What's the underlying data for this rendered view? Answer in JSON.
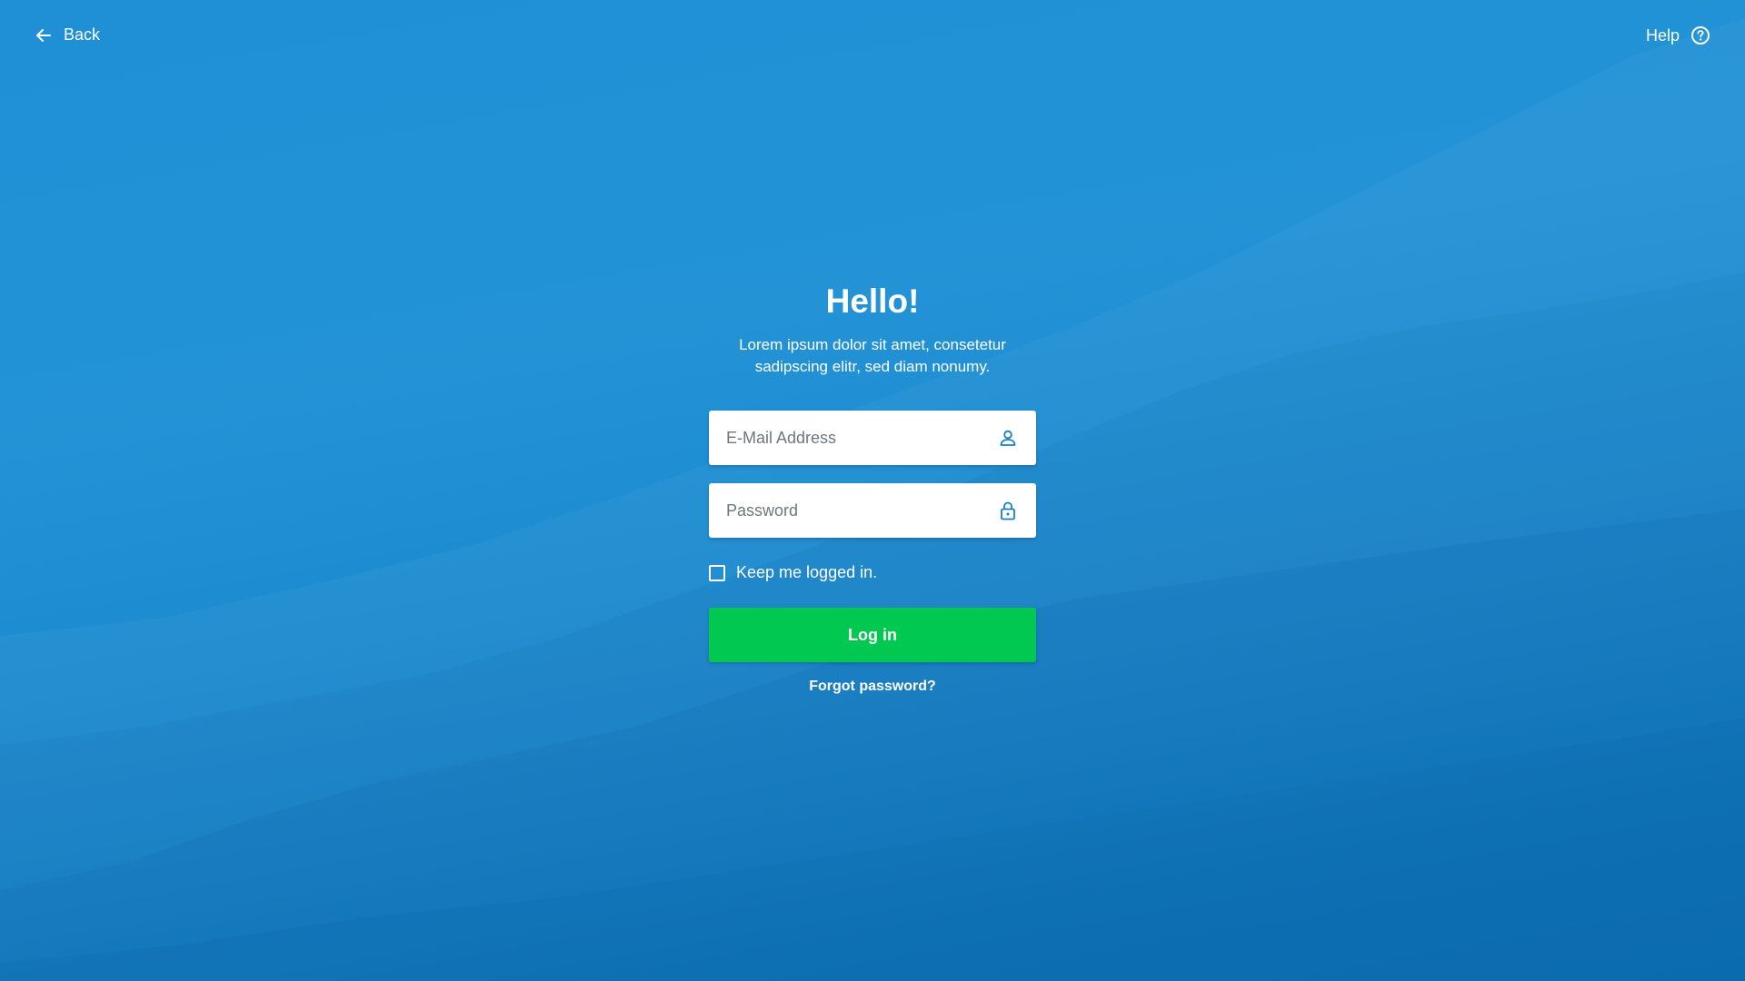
{
  "header": {
    "back_label": "Back",
    "help_label": "Help"
  },
  "login": {
    "title": "Hello!",
    "subtitle_line1": "Lorem ipsum dolor sit amet, consetetur",
    "subtitle_line2": "sadipscing elitr, sed diam nonumy.",
    "email_placeholder": "E-Mail Address",
    "password_placeholder": "Password",
    "remember_label": "Keep me logged in.",
    "remember_checked": false,
    "submit_label": "Log in",
    "forgot_label": "Forgot password?"
  },
  "icons": {
    "back": "arrow-left-icon",
    "help": "question-circle-icon",
    "email": "user-icon",
    "password": "lock-icon"
  },
  "colors": {
    "background": "#1f90d6",
    "primary_button": "#00c851",
    "input_icon": "#1a7fc4",
    "text": "#ffffff"
  }
}
